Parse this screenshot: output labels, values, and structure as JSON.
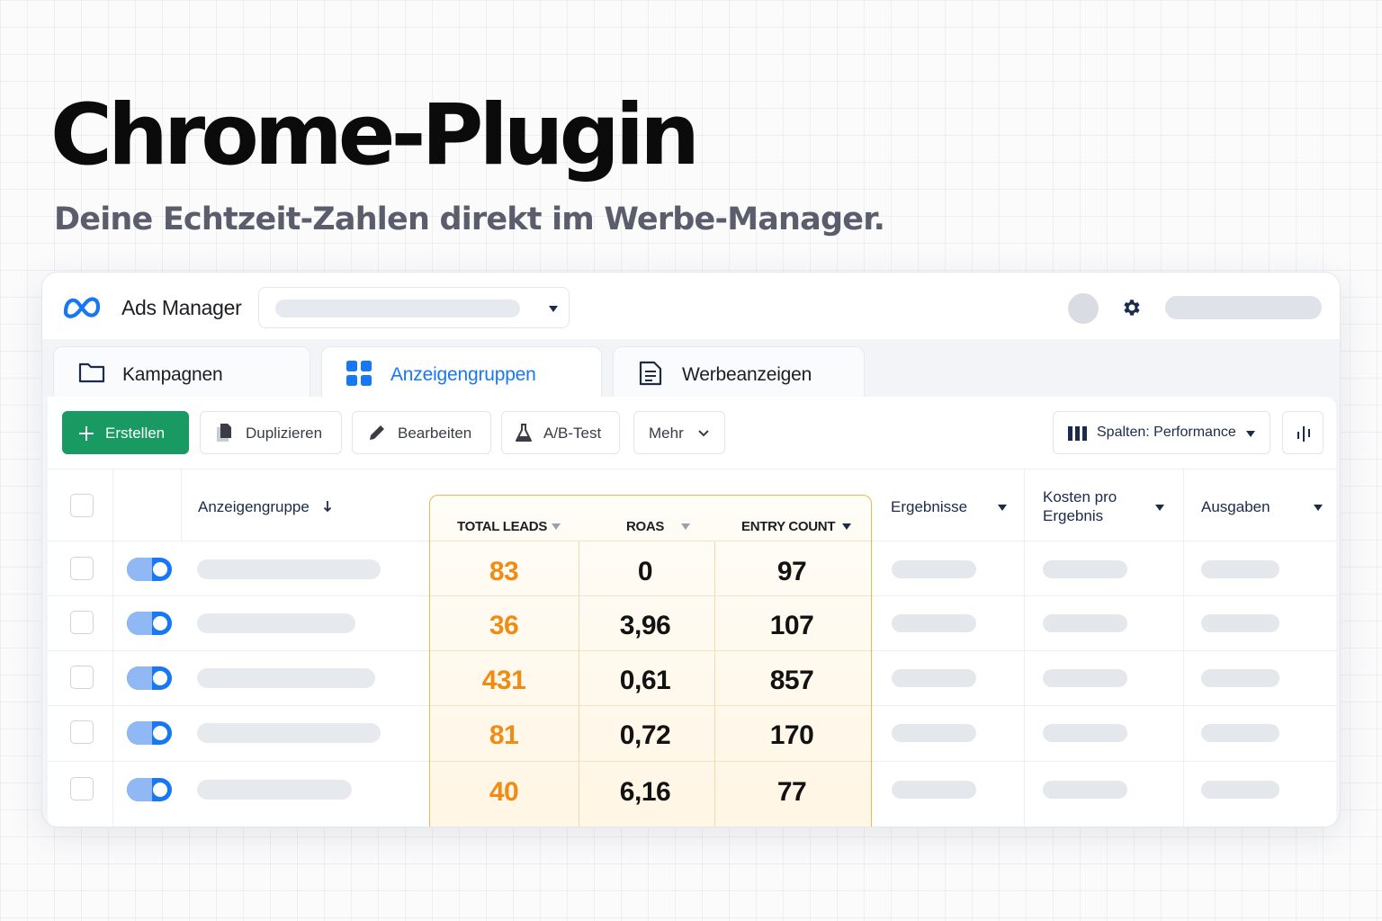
{
  "hero": {
    "title": "Chrome-Plugin",
    "subtitle": "Deine Echtzeit-Zahlen direkt im Werbe-Manager."
  },
  "header": {
    "app_title": "Ads Manager",
    "logo_icon": "meta-logo-icon",
    "settings_icon": "gear-icon"
  },
  "tabs": [
    {
      "label": "Kampagnen",
      "icon": "folder-icon",
      "active": false
    },
    {
      "label": "Anzeigengruppen",
      "icon": "grid-icon",
      "active": true
    },
    {
      "label": "Werbeanzeigen",
      "icon": "document-icon",
      "active": false
    }
  ],
  "toolbar": {
    "create": "Erstellen",
    "duplicate": "Duplizieren",
    "edit": "Bearbeiten",
    "ab_test": "A/B-Test",
    "more": "Mehr",
    "columns": "Spalten: Performance"
  },
  "table": {
    "headers": {
      "adset": "Anzeigengruppe",
      "total_leads": "TOTAL LEADS",
      "roas": "ROAS",
      "entry_count": "ENTRY COUNT",
      "results": "Ergebnisse",
      "cost_per_result_line1": "Kosten pro",
      "cost_per_result_line2": "Ergebnis",
      "spend": "Ausgaben"
    },
    "rows": [
      {
        "total_leads": "83",
        "roas": "0",
        "entry_count": "97",
        "active": true
      },
      {
        "total_leads": "36",
        "roas": "3,96",
        "entry_count": "107",
        "active": true
      },
      {
        "total_leads": "431",
        "roas": "0,61",
        "entry_count": "857",
        "active": true
      },
      {
        "total_leads": "81",
        "roas": "0,72",
        "entry_count": "170",
        "active": true
      },
      {
        "total_leads": "40",
        "roas": "6,16",
        "entry_count": "77",
        "active": true
      }
    ]
  },
  "colors": {
    "accent_blue": "#1877f2",
    "create_green": "#199a63",
    "leads_orange": "#f08c14",
    "highlight_border": "#f5b54b"
  }
}
